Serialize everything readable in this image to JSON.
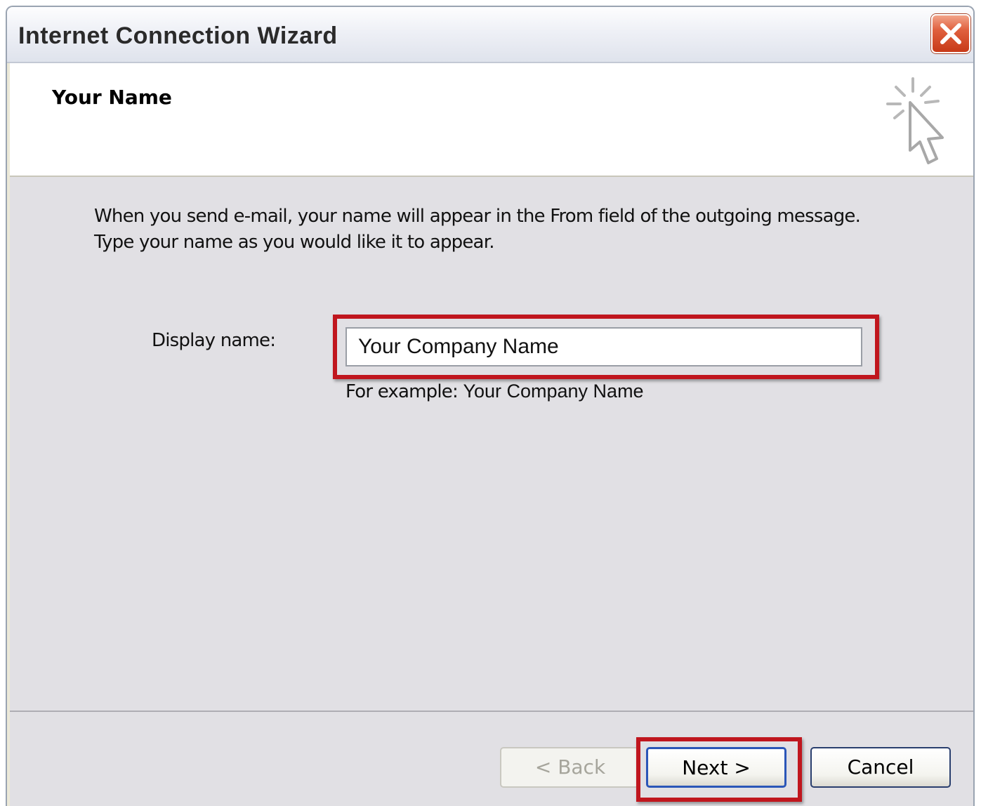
{
  "window": {
    "title": "Internet Connection Wizard",
    "close_icon": "close-x-icon"
  },
  "header": {
    "title": "Your Name",
    "icon": "wizard-sparkle-cursor-icon"
  },
  "body": {
    "intro_line1": "When you send e-mail, your name will appear in the From field of the outgoing message.",
    "intro_line2": "Type your name as you would like it to appear.",
    "display_name_label": "Display name:",
    "display_name_value": "Your Company Name",
    "example_prefix": "For example:",
    "example_value": "Your Company Name"
  },
  "footer": {
    "back_label": "< Back",
    "next_label": "Next >",
    "cancel_label": "Cancel"
  },
  "colors": {
    "highlight": "#c0161e",
    "dialog_bg": "#e1e0e4",
    "default_button_border": "#2b56b8"
  }
}
